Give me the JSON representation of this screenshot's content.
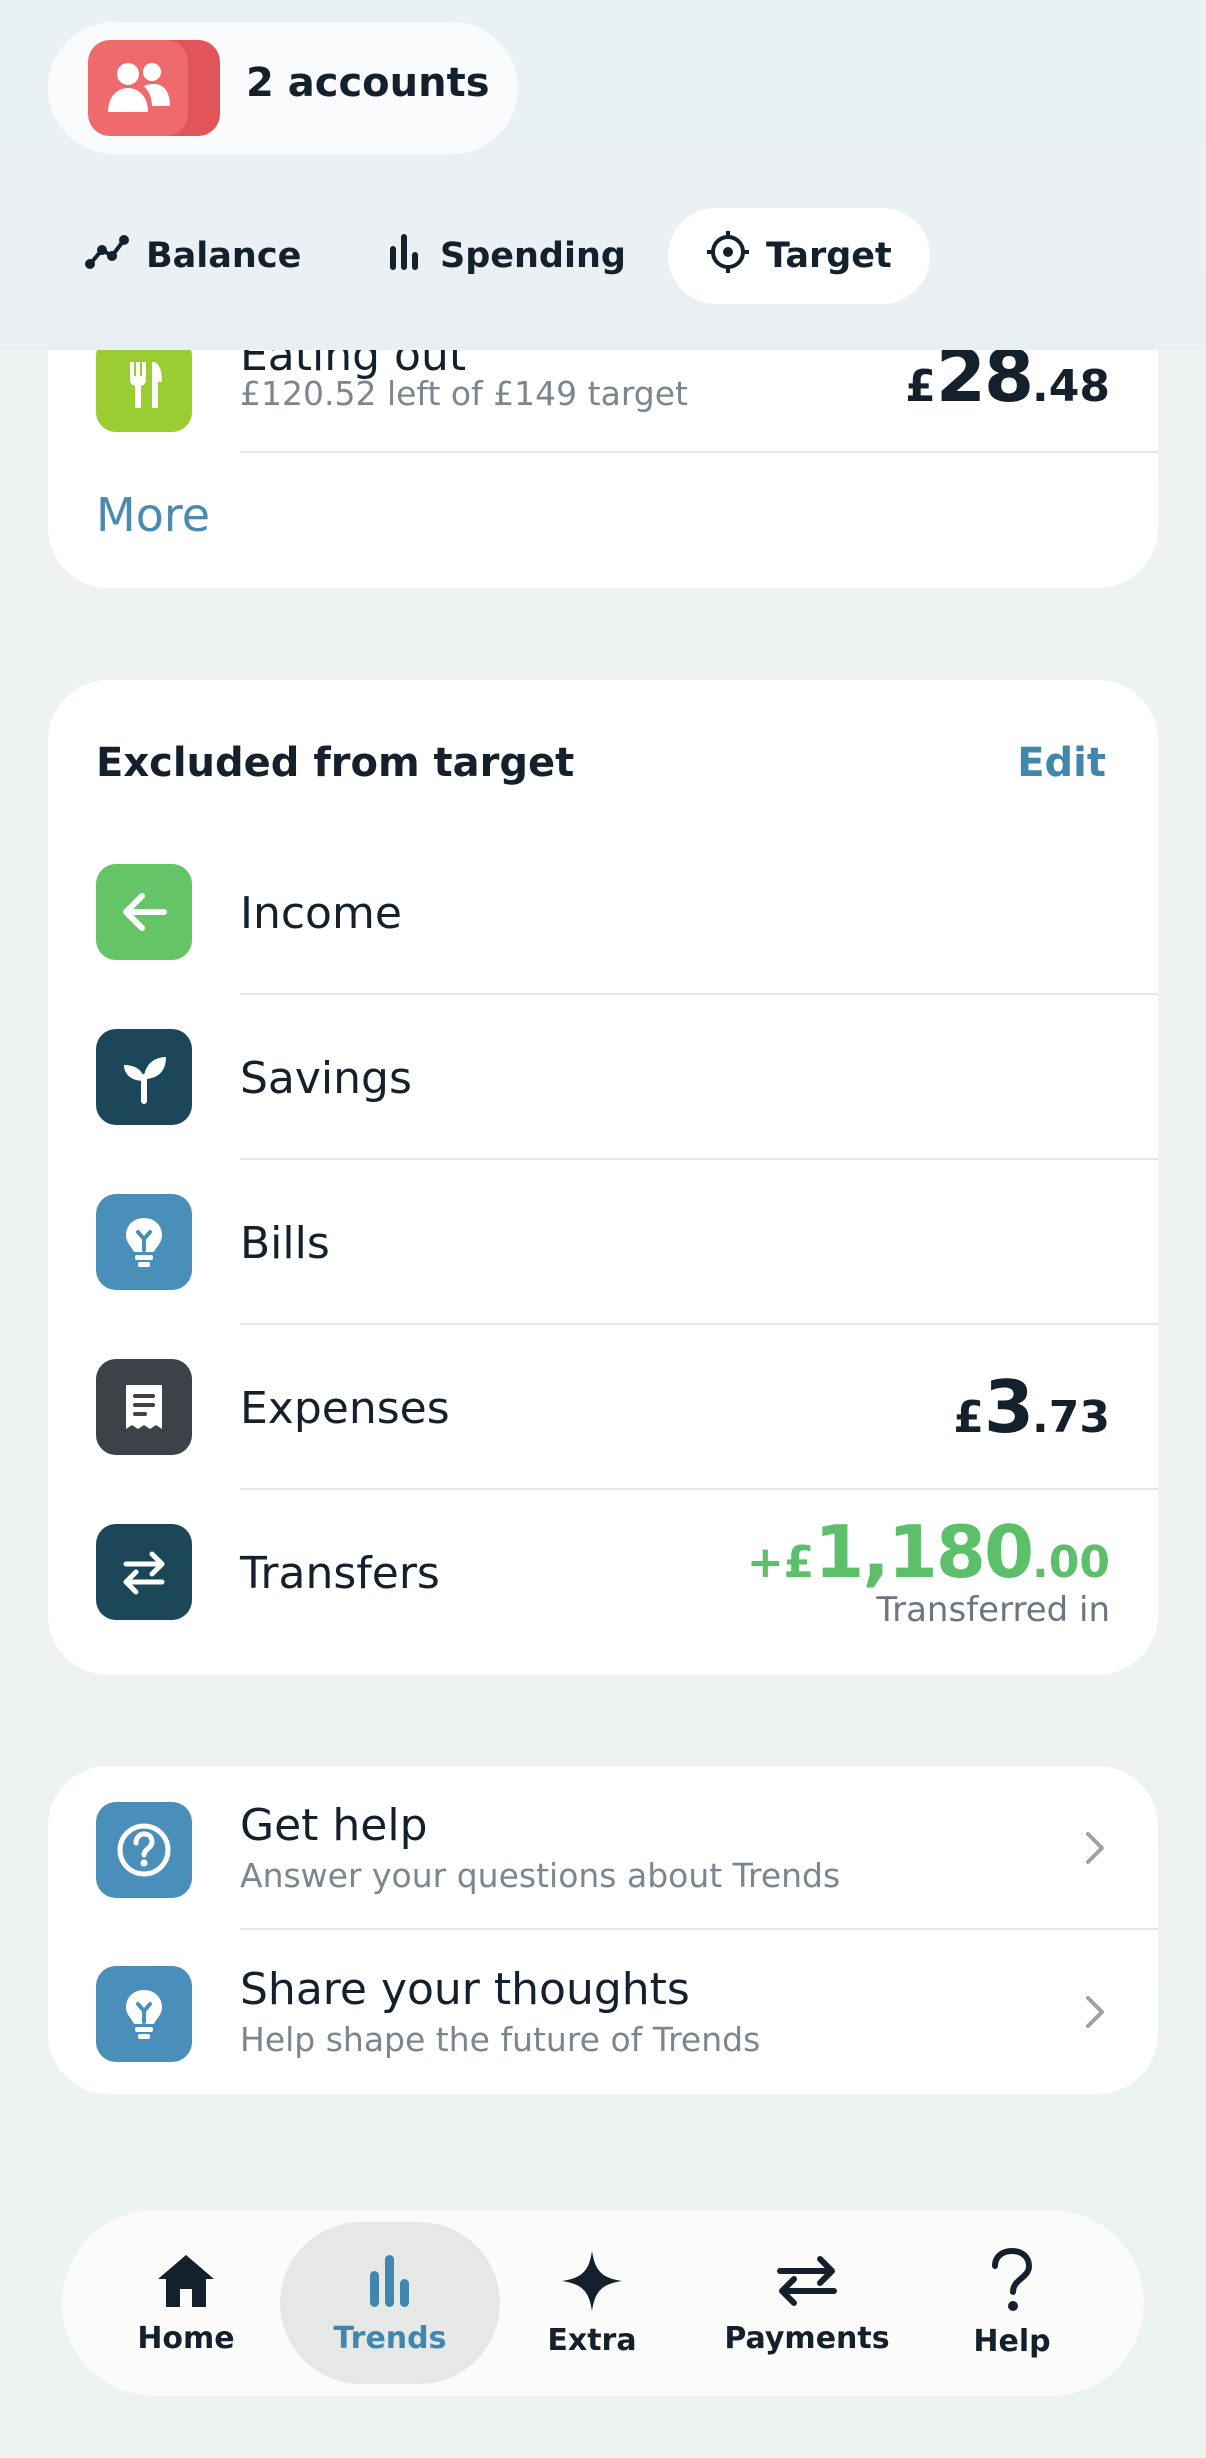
{
  "header": {
    "accounts_label": "2 accounts",
    "tabs": [
      {
        "label": "Balance",
        "icon": "line-chart-icon",
        "active": false
      },
      {
        "label": "Spending",
        "icon": "bar-chart-icon",
        "active": false
      },
      {
        "label": "Target",
        "icon": "target-icon",
        "active": true
      }
    ]
  },
  "targets": {
    "partial_row": {
      "title": "Eating out",
      "subtitle": "£120.52 left of £149 target",
      "amount_currency": "£",
      "amount_whole": "28",
      "amount_decimal": ".48",
      "icon": "fork-knife-icon",
      "icon_color": "#9acd32"
    },
    "more_label": "More"
  },
  "excluded": {
    "title": "Excluded from target",
    "edit_label": "Edit",
    "items": [
      {
        "label": "Income",
        "icon": "arrow-left-icon",
        "color": "#64c466"
      },
      {
        "label": "Savings",
        "icon": "sprout-icon",
        "color": "#1c4759"
      },
      {
        "label": "Bills",
        "icon": "lightbulb-icon",
        "color": "#4a8fba"
      },
      {
        "label": "Expenses",
        "icon": "receipt-icon",
        "color": "#3c4247",
        "amount_currency": "£",
        "amount_whole": "3",
        "amount_decimal": ".73"
      },
      {
        "label": "Transfers",
        "icon": "transfer-arrows-icon",
        "color": "#1c4759",
        "amount_currency": "+£",
        "amount_whole": "1,180",
        "amount_decimal": ".00",
        "caption": "Transferred in",
        "amount_color": "#5cbf6a"
      }
    ]
  },
  "help": {
    "items": [
      {
        "title": "Get help",
        "subtitle": "Answer your questions about Trends",
        "icon": "question-circle-icon",
        "color": "#4a8fba"
      },
      {
        "title": "Share your thoughts",
        "subtitle": "Help shape the future of Trends",
        "icon": "lightbulb-icon",
        "color": "#4a8fba"
      }
    ]
  },
  "bottom_nav": {
    "items": [
      {
        "label": "Home",
        "icon": "home-icon",
        "active": false
      },
      {
        "label": "Trends",
        "icon": "bar-chart-icon",
        "active": true
      },
      {
        "label": "Extra",
        "icon": "sparkle-icon",
        "active": false
      },
      {
        "label": "Payments",
        "icon": "transfer-arrows-icon",
        "active": false
      },
      {
        "label": "Help",
        "icon": "question-mark-icon",
        "active": false
      }
    ]
  }
}
